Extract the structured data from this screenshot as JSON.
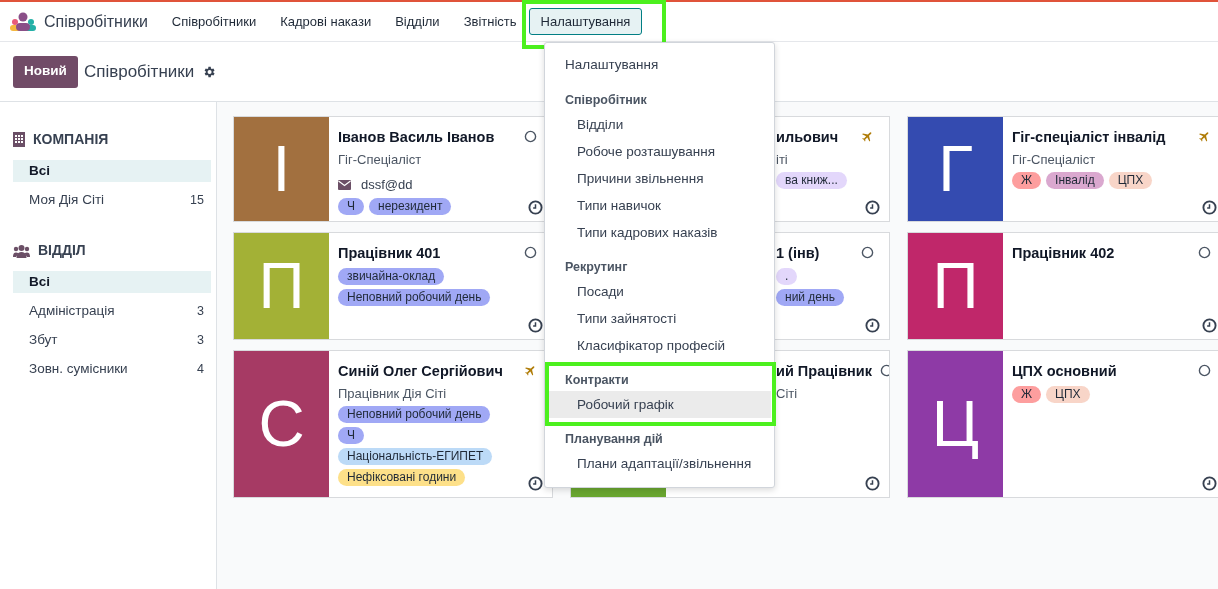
{
  "navbar": {
    "app_name": "Співробітники",
    "menu": [
      {
        "label": "Співробітники",
        "selected": false
      },
      {
        "label": "Кадрові накази",
        "selected": false
      },
      {
        "label": "Відділи",
        "selected": false
      },
      {
        "label": "Звітність",
        "selected": false
      },
      {
        "label": "Налаштування",
        "selected": true
      }
    ]
  },
  "control_panel": {
    "new_button": "Новий",
    "breadcrumb": "Співробітники"
  },
  "sidebar": {
    "sections": [
      {
        "kind": "company",
        "title": "КОМПАНІЯ",
        "items": [
          {
            "label": "Всі",
            "selected": true
          },
          {
            "label": "Моя Дія Сіті",
            "count": "15",
            "selected": false
          }
        ]
      },
      {
        "kind": "department",
        "title": "ВІДДІЛ",
        "items": [
          {
            "label": "Всі",
            "selected": true
          },
          {
            "label": "Адміністрація",
            "count": "3",
            "selected": false
          },
          {
            "label": "Збут",
            "count": "3",
            "selected": false
          },
          {
            "label": "Зовн. сумісники",
            "count": "4",
            "selected": false
          }
        ]
      }
    ]
  },
  "columns": [
    {
      "cards": [
        {
          "letter": "І",
          "color": "#a2703f",
          "name": "Іванов Василь Іванов",
          "job": "Гіг-Спеціаліст",
          "email": "dssf@dd",
          "on_leave": false,
          "tags": [
            {
              "label": "Ч",
              "color": "#a0a8f5"
            },
            {
              "label": "нерезидент",
              "color": "#a0a8f5"
            }
          ]
        },
        {
          "letter": "П",
          "color": "#a3b136",
          "name": "Працівник 401",
          "on_leave": false,
          "tags": [
            {
              "label": "звичайна-оклад",
              "color": "#a0a8f5"
            },
            {
              "label": "Неповний робочий день",
              "color": "#a0a8f5"
            }
          ]
        },
        {
          "letter": "С",
          "color": "#a63a64",
          "name": "Синій Олег Сергійович",
          "job": "Працівник Дія Сіті",
          "on_leave": true,
          "tags": [
            {
              "label": "Неповний робочий день",
              "color": "#a0a8f5"
            },
            {
              "label": "Ч",
              "color": "#a0a8f5"
            },
            {
              "label": "Національність-ЕГИПЕТ",
              "color": "#bcdaf7"
            },
            {
              "label": "Нефіксовані години",
              "color": "#fde089"
            }
          ]
        }
      ]
    },
    {
      "cards": [
        {
          "name": "ильович",
          "job": "іті",
          "on_leave": true,
          "tags": [
            {
              "label": "ва книж...",
              "color": "#e3d7fb"
            }
          ]
        },
        {
          "name": "1 (інв)",
          "on_leave": false,
          "tags": [
            {
              "label": ".",
              "color": "#e3d7fb"
            },
            {
              "label": "ний день",
              "color": "#a0a8f5"
            }
          ]
        },
        {
          "color": "#6aa630",
          "name": "ий Працівник",
          "job": "Сіті",
          "on_leave": false
        }
      ]
    },
    {
      "cards": [
        {
          "letter": "Г",
          "color": "#344bb0",
          "name": "Гіг-спеціаліст інвалід",
          "job": "Гіг-Спеціаліст",
          "on_leave": true,
          "tags": [
            {
              "label": "Ж",
              "color": "#fd9e9e"
            },
            {
              "label": "Інвалід",
              "color": "#daa8cf"
            },
            {
              "label": "ЦПХ",
              "color": "#f8d5c8"
            }
          ]
        },
        {
          "letter": "П",
          "color": "#c0276a",
          "name": "Працівник 402",
          "on_leave": false
        },
        {
          "letter": "Ц",
          "color": "#8e3aa6",
          "name": "ЦПХ основний",
          "on_leave": false,
          "tags": [
            {
              "label": "Ж",
              "color": "#fd9e9e"
            },
            {
              "label": "ЦПХ",
              "color": "#f8d5c8"
            }
          ]
        }
      ]
    }
  ],
  "dropdown": {
    "entries": [
      {
        "kind": "item",
        "label": "Налаштування",
        "selected": false
      },
      {
        "kind": "header",
        "label": "Співробітник",
        "children": [
          {
            "label": "Відділи",
            "selected": false
          },
          {
            "label": "Робоче розташування",
            "selected": false
          },
          {
            "label": "Причини звільнення",
            "selected": false
          },
          {
            "label": "Типи навичок",
            "selected": false
          },
          {
            "label": "Типи кадрових наказів",
            "selected": false
          }
        ]
      },
      {
        "kind": "header",
        "label": "Рекрутинг",
        "children": [
          {
            "label": "Посади",
            "selected": false
          },
          {
            "label": "Типи зайнятості",
            "selected": false
          },
          {
            "label": "Класифікатор професій",
            "selected": false
          }
        ]
      },
      {
        "kind": "header",
        "label": "Контракти",
        "children": [
          {
            "label": "Робочий графік",
            "selected": true
          }
        ]
      },
      {
        "kind": "header",
        "label": "Планування дій",
        "children": [
          {
            "label": "Плани адаптації/звільнення",
            "selected": false
          }
        ]
      }
    ]
  }
}
